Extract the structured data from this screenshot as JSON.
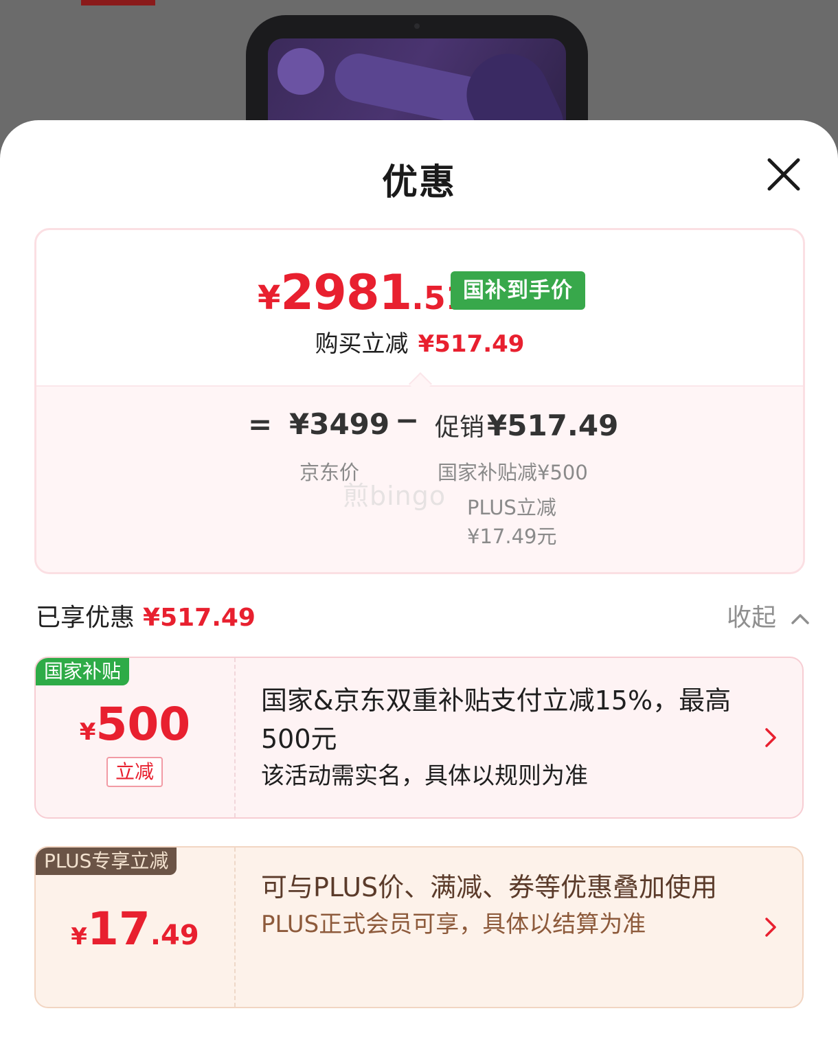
{
  "sheet": {
    "title": "优惠"
  },
  "price_card": {
    "final_price": {
      "yen": "¥",
      "int": "2981",
      "dec": ".51"
    },
    "badge": "国补到手价",
    "save_label": "购买立减",
    "save_amount": "¥517.49",
    "equals": "=",
    "jd_price": "¥3499",
    "minus": "−",
    "promo_label": "促销",
    "promo_amount": "¥517.49",
    "jd_caption": "京东价",
    "gov_caption": "国家补贴减¥500",
    "plus_caption_1": "PLUS立减",
    "plus_caption_2": "¥17.49元",
    "watermark": "煎bingo"
  },
  "enjoyed": {
    "label": "已享优惠",
    "amount": "¥517.49",
    "collapse_label": "收起"
  },
  "coupons": [
    {
      "tag": "国家补贴",
      "yen": "¥",
      "amount_int": "500",
      "amount_dec": "",
      "reduce_label": "立减",
      "title": "国家&京东双重补贴支付立减15%，最高500元",
      "subtitle": "该活动需实名，具体以规则为准"
    },
    {
      "tag": "PLUS专享立减",
      "yen": "¥",
      "amount_int": "17",
      "amount_dec": ".49",
      "title": "可与PLUS价、满减、券等优惠叠加使用",
      "subtitle": "PLUS正式会员可享，具体以结算为准"
    }
  ],
  "icons": {
    "close": "close-icon",
    "collapse": "chevron-up-icon",
    "coupon_arrow": "chevron-right-icon"
  },
  "colors": {
    "price_red": "#e8202f",
    "badge_green": "#38a84b",
    "plus_brown": "#6b5446"
  }
}
